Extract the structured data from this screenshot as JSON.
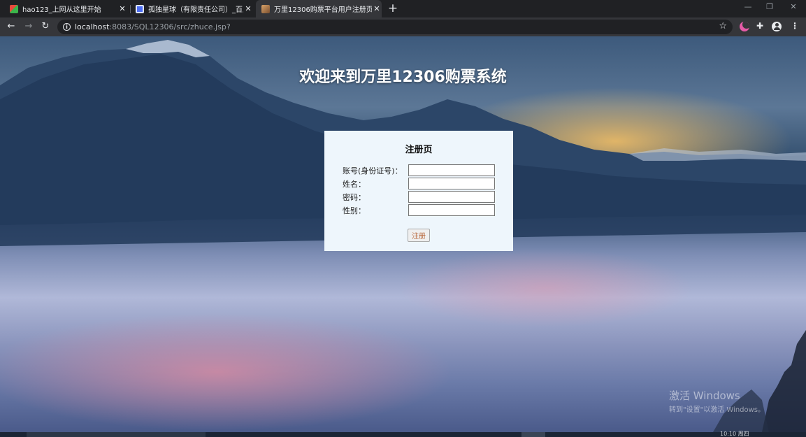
{
  "browser": {
    "tabs": [
      {
        "title": "hao123_上网从这里开始",
        "active": false,
        "favicon": "hao123-icon"
      },
      {
        "title": "孤独星球（有限责任公司）_百度",
        "active": false,
        "favicon": "baidu-icon"
      },
      {
        "title": "万里12306购票平台用户注册页",
        "active": true,
        "favicon": "page-icon"
      }
    ],
    "tab_close_glyph": "✕",
    "new_tab_glyph": "+",
    "window_controls": {
      "minimize": "—",
      "restore": "❐",
      "close": "✕"
    },
    "nav": {
      "back": "←",
      "forward": "→",
      "reload": "↻"
    },
    "url": {
      "host": "localhost",
      "rest": ":8083/SQL12306/src/zhuce.jsp?"
    },
    "info_glyph": "i",
    "star_glyph": "☆",
    "extensions": [
      "moon-icon",
      "puzzle-icon",
      "profile-icon"
    ],
    "puzzle_glyph": "✚",
    "menu_glyph": "⋮"
  },
  "page": {
    "title": "欢迎来到万里12306购票系统",
    "form": {
      "heading": "注册页",
      "fields": [
        {
          "label": "账号(身份证号)：",
          "value": ""
        },
        {
          "label": "姓名：",
          "value": ""
        },
        {
          "label": "密码：",
          "value": ""
        },
        {
          "label": "性别：",
          "value": ""
        }
      ],
      "submit_label": "注册"
    },
    "watermark": {
      "title": "激活 Windows",
      "subtitle": "转到\"设置\"以激活 Windows。"
    }
  },
  "taskbar": {
    "clock": "10:10 周四"
  },
  "colors": {
    "tab_strip": "#202124",
    "toolbar": "#35363a",
    "form_bg": "#eef6fc",
    "button_text": "#b8683c"
  }
}
